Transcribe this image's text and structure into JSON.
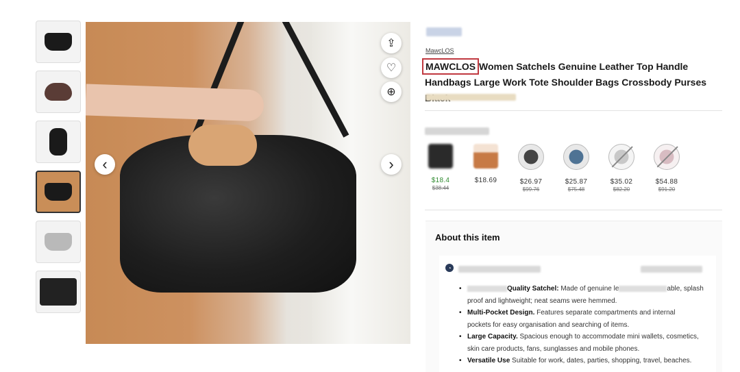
{
  "gallery": {
    "thumbnails": [
      {
        "name": "front"
      },
      {
        "name": "interior"
      },
      {
        "name": "side"
      },
      {
        "name": "model",
        "active": true
      },
      {
        "name": "silver"
      },
      {
        "name": "detail"
      }
    ]
  },
  "image_controls": {
    "share_icon": "share-icon",
    "favorite_icon": "heart-icon",
    "zoom_icon": "zoom-in-icon",
    "prev_glyph": "‹",
    "next_glyph": "›",
    "share_glyph": "⇪",
    "favorite_glyph": "♡",
    "zoom_glyph": "⊕"
  },
  "product": {
    "brand_link": "MawcLOS",
    "brand_highlight": "MAWCLOS",
    "title_rest": " Women Satchels Genuine Leather Top Handle Handbags Large Work Tote Shoulder Bags Crossbody Purses Black",
    "highlight_color": "#c0383f"
  },
  "variants": [
    {
      "swatch": "black",
      "price": "$18.4",
      "was": "$38.44",
      "available": true,
      "price_color": "green"
    },
    {
      "swatch": "brown",
      "price": "$18.69",
      "was": "",
      "available": true,
      "price_color": "normal"
    },
    {
      "swatch": "dark",
      "price": "$26.97",
      "was": "$99.76",
      "available": true,
      "price_color": "normal"
    },
    {
      "swatch": "blue",
      "price": "$25.87",
      "was": "$75.48",
      "available": true,
      "price_color": "normal"
    },
    {
      "swatch": "grey",
      "price": "$35.02",
      "was": "$82.20",
      "available": false,
      "price_color": "normal"
    },
    {
      "swatch": "pink",
      "price": "$54.88",
      "was": "$91.20",
      "available": false,
      "price_color": "normal"
    }
  ],
  "about": {
    "heading": "About this item",
    "ai_glyph": "◔",
    "bullets": [
      {
        "lead": "Quality Satchel:",
        "text": " Made of genuine le",
        "tail": "able, splash"
      },
      {
        "lead": "",
        "text": "proof and lightweight; neat seams were hemmed.",
        "tail": ""
      },
      {
        "lead": "Multi-Pocket Design.",
        "text": " Features separate compartments and internal",
        "tail": ""
      },
      {
        "lead": "",
        "text": "pockets for easy organisation and searching of items.",
        "tail": ""
      },
      {
        "lead": "Large Capacity.",
        "text": " Spacious enough to accommodate mini wallets, cosmetics,",
        "tail": ""
      },
      {
        "lead": "",
        "text": "skin care products, fans, sunglasses and mobile phones.",
        "tail": ""
      },
      {
        "lead": "Versatile Use",
        "text": " Suitable for work, dates, parties, shopping, travel, beaches.",
        "tail": ""
      }
    ]
  }
}
